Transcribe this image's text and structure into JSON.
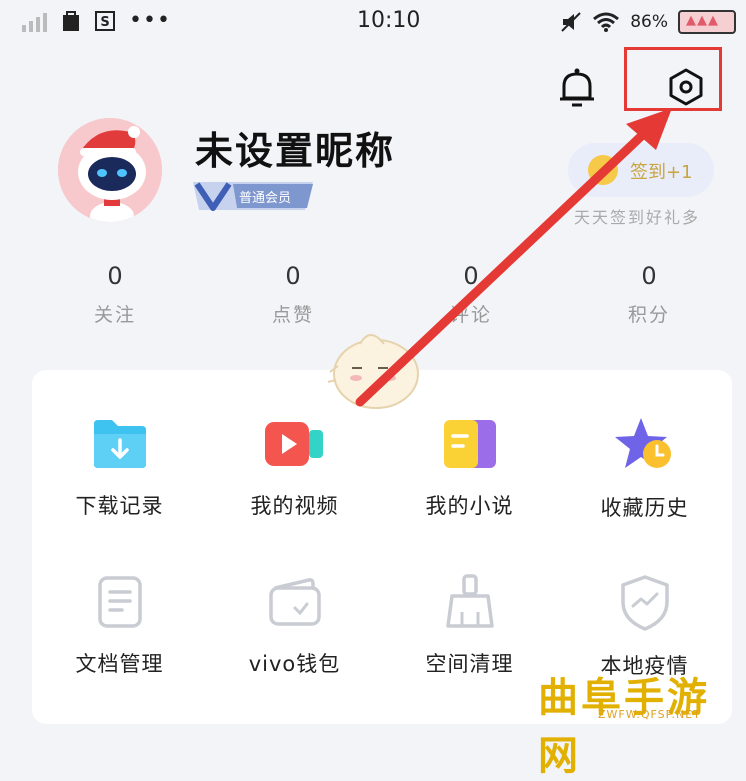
{
  "status_bar": {
    "time": "10:10",
    "battery_percent": "86%",
    "icons": [
      "signal-icon",
      "bag-icon",
      "s-app-icon",
      "more-dots-icon",
      "mute-icon",
      "wifi-icon",
      "battery-icon"
    ]
  },
  "header": {
    "bell_icon": "bell-icon",
    "settings_icon": "settings-hexagon-icon"
  },
  "profile": {
    "nickname": "未设置昵称",
    "member_badge": "普通会员",
    "signin_label": "签到+1",
    "signin_hint": "天天签到好礼多"
  },
  "stats": [
    {
      "value": "0",
      "label": "关注"
    },
    {
      "value": "0",
      "label": "点赞"
    },
    {
      "value": "0",
      "label": "评论"
    },
    {
      "value": "0",
      "label": "积分"
    }
  ],
  "menu": [
    {
      "label": "下载记录",
      "icon": "download-folder-icon"
    },
    {
      "label": "我的视频",
      "icon": "video-icon"
    },
    {
      "label": "我的小说",
      "icon": "novel-book-icon"
    },
    {
      "label": "收藏历史",
      "icon": "star-clock-icon"
    },
    {
      "label": "文档管理",
      "icon": "document-icon"
    },
    {
      "label": "vivo钱包",
      "icon": "wallet-icon"
    },
    {
      "label": "空间清理",
      "icon": "broom-icon"
    },
    {
      "label": "本地疫情",
      "icon": "shield-chart-icon"
    }
  ],
  "colors": {
    "highlight_box": "#e53935",
    "arrow": "#e53935",
    "background": "#f3f4f8",
    "card": "#ffffff"
  },
  "watermark": {
    "text": "曲阜手游网",
    "sub": "ZWFW.QFSP.NET"
  }
}
